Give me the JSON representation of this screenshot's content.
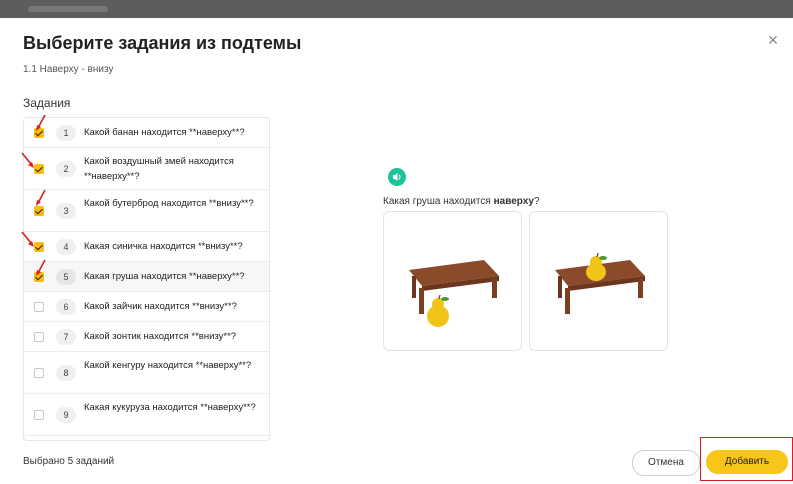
{
  "modal": {
    "title": "Выберите задания из подтемы",
    "subtitle": "1.1 Наверху - внизу",
    "section_label": "Задания",
    "close_glyph": "×"
  },
  "tasks": [
    {
      "num": "1",
      "text": "Какой банан находится **наверху**?",
      "checked": true
    },
    {
      "num": "2",
      "text": "Какой воздушный змей находится **наверху**?",
      "checked": true
    },
    {
      "num": "3",
      "text": "Какой бутерброд находится **внизу**?",
      "checked": true
    },
    {
      "num": "4",
      "text": "Какая синичка находится **внизу**?",
      "checked": true
    },
    {
      "num": "5",
      "text": "Какая груша находится **наверху**?",
      "checked": true
    },
    {
      "num": "6",
      "text": "Какой зайчик находится **внизу**?",
      "checked": false
    },
    {
      "num": "7",
      "text": "Какой зонтик находится **внизу**?",
      "checked": false
    },
    {
      "num": "8",
      "text": "Какой кенгуру находится **наверху**?",
      "checked": false
    },
    {
      "num": "9",
      "text": "Какая кукуруза находится **наверху**?",
      "checked": false
    }
  ],
  "preview": {
    "question_prefix": "Какая груша находится ",
    "question_bold": "наверху",
    "question_suffix": "?",
    "audio_icon": "speaker-icon"
  },
  "footer": {
    "selected_text": "Выбрано 5 заданий",
    "cancel_label": "Отмена",
    "add_label": "Добавить"
  },
  "colors": {
    "accent": "#f7c619",
    "checkbox": "#f7bd12",
    "audio": "#1ec29a",
    "highlight": "#d42020"
  }
}
